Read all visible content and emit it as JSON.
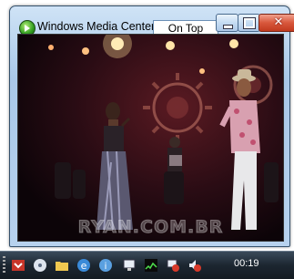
{
  "window": {
    "title": "Windows Media Center",
    "ontop_label": "On Top",
    "close_label": "✕"
  },
  "video": {
    "watermark": "RYAN.COM.BR"
  },
  "taskbar": {
    "clock": "00:19",
    "icons": [
      "show-desktop-icon",
      "cd-player-icon",
      "folder-icon",
      "internet-explorer-icon",
      "info-icon",
      "network-icon",
      "sound-meter-icon",
      "network-error-icon",
      "volume-muted-icon"
    ]
  },
  "colors": {
    "taskbar": "#1c2630",
    "window_frame": "#a9c8e8",
    "close_button": "#d8573c"
  }
}
